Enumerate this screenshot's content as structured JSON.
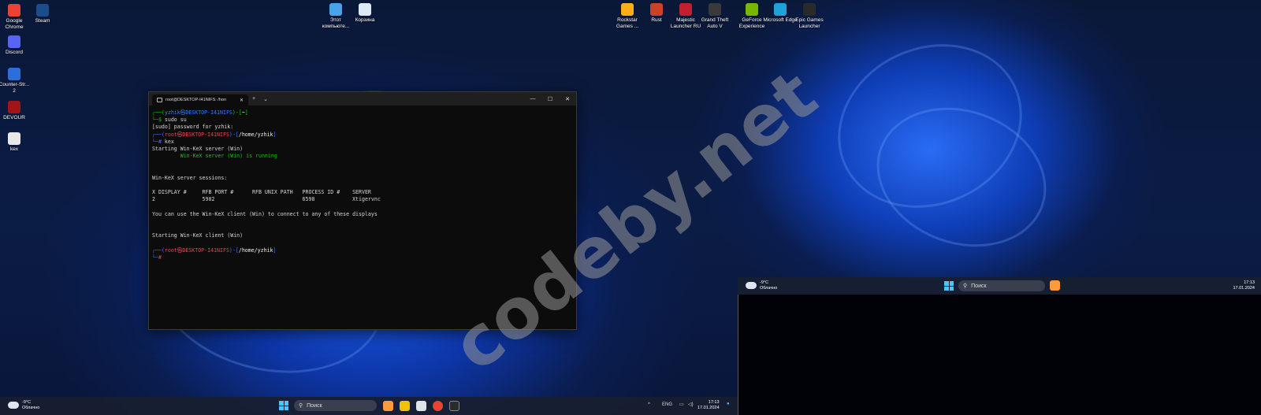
{
  "desktop_icons_left": [
    {
      "label": "Google Chrome",
      "icon": "chrome-icon",
      "color": "#ea4335"
    },
    {
      "label": "Steam",
      "icon": "steam-icon",
      "color": "#1b4d8a"
    },
    {
      "label": "Discord",
      "icon": "discord-icon",
      "color": "#5865f2"
    },
    {
      "label": "Counter-Str... 2",
      "icon": "cs2-icon",
      "color": "#2d6fd8"
    },
    {
      "label": "DEVOUR",
      "icon": "devour-icon",
      "color": "#a01616"
    },
    {
      "label": "kex",
      "icon": "file-icon",
      "color": "#e8e8e8"
    }
  ],
  "desktop_icons_mid": [
    {
      "label": "Этот компьюте...",
      "icon": "computer-icon",
      "color": "#4aa3e8"
    },
    {
      "label": "Корзина",
      "icon": "recycle-bin-icon",
      "color": "#dfe9f5"
    }
  ],
  "desktop_icons_right": [
    {
      "label": "Rockstar Games ...",
      "icon": "rockstar-icon",
      "color": "#fcaf17"
    },
    {
      "label": "Rust",
      "icon": "rust-icon",
      "color": "#cd412b"
    },
    {
      "label": "Majestic Launcher RU",
      "icon": "majestic-icon",
      "color": "#c21f2f"
    },
    {
      "label": "Grand Theft Auto V",
      "icon": "gta-icon",
      "color": "#3a3a3a"
    },
    {
      "label": "GeForce Experience",
      "icon": "geforce-icon",
      "color": "#76b900"
    },
    {
      "label": "Microsoft Edge",
      "icon": "edge-icon",
      "color": "#1fa2d8"
    },
    {
      "label": "Epic Games Launcher",
      "icon": "epic-icon",
      "color": "#2a2a2a"
    }
  ],
  "terminal": {
    "tab_title": "root@DESKTOP-I41NIFS: /hon",
    "new_tab": "+",
    "dropdown": "⌄",
    "minimize": "—",
    "maximize": "☐",
    "close": "✕",
    "lines": [
      {
        "parts": [
          {
            "t": "┌──(",
            "c": "c-green"
          },
          {
            "t": "yzhik㉿DESKTOP-I41NIFS",
            "c": "c-blue"
          },
          {
            "t": ")-[",
            "c": "c-green"
          },
          {
            "t": "~",
            "c": "c-white"
          },
          {
            "t": "]",
            "c": "c-green"
          }
        ]
      },
      {
        "parts": [
          {
            "t": "└─$ ",
            "c": "c-green"
          },
          {
            "t": "sudo su",
            "c": ""
          }
        ]
      },
      {
        "parts": [
          {
            "t": "[sudo] password for yzhik:",
            "c": ""
          }
        ]
      },
      {
        "parts": [
          {
            "t": "┌──(",
            "c": "c-blue"
          },
          {
            "t": "root㉿DESKTOP-I41NIFS",
            "c": "c-red"
          },
          {
            "t": ")-[",
            "c": "c-blue"
          },
          {
            "t": "/home/yzhik",
            "c": "c-white"
          },
          {
            "t": "]",
            "c": "c-blue"
          }
        ]
      },
      {
        "parts": [
          {
            "t": "└─# ",
            "c": "c-blue"
          },
          {
            "t": "kex",
            "c": ""
          }
        ]
      },
      {
        "parts": [
          {
            "t": "Starting Win-KeX server (Win)",
            "c": ""
          }
        ]
      },
      {
        "parts": [
          {
            "t": "         Win-KeX server (Win) is running",
            "c": "c-green"
          }
        ]
      },
      {
        "parts": [
          {
            "t": " ",
            "c": ""
          }
        ]
      },
      {
        "parts": [
          {
            "t": " ",
            "c": ""
          }
        ]
      },
      {
        "parts": [
          {
            "t": "Win-KeX server sessions:",
            "c": ""
          }
        ]
      },
      {
        "parts": [
          {
            "t": " ",
            "c": ""
          }
        ]
      },
      {
        "parts": [
          {
            "t": "X DISPLAY #     RFB PORT #      RFB UNIX PATH   PROCESS ID #    SERVER",
            "c": ""
          }
        ]
      },
      {
        "parts": [
          {
            "t": "2               5902                            6598            Xtigervnc",
            "c": ""
          }
        ]
      },
      {
        "parts": [
          {
            "t": " ",
            "c": ""
          }
        ]
      },
      {
        "parts": [
          {
            "t": "You can use the Win-KeX client (Win) to connect to any of these displays",
            "c": ""
          }
        ]
      },
      {
        "parts": [
          {
            "t": " ",
            "c": ""
          }
        ]
      },
      {
        "parts": [
          {
            "t": " ",
            "c": ""
          }
        ]
      },
      {
        "parts": [
          {
            "t": "Starting Win-KeX client (Win)",
            "c": ""
          }
        ]
      },
      {
        "parts": [
          {
            "t": " ",
            "c": ""
          }
        ]
      },
      {
        "parts": [
          {
            "t": "┌──(",
            "c": "c-blue"
          },
          {
            "t": "root㉿DESKTOP-I41NIFS",
            "c": "c-red"
          },
          {
            "t": ")-[",
            "c": "c-blue"
          },
          {
            "t": "/home/yzhik",
            "c": "c-white"
          },
          {
            "t": "]",
            "c": "c-blue"
          }
        ]
      },
      {
        "parts": [
          {
            "t": "└─",
            "c": "c-blue"
          },
          {
            "t": "#",
            "c": "c-red"
          }
        ]
      }
    ]
  },
  "watermark": "codeby.net",
  "taskbar_main": {
    "temp": "-9°C",
    "weather": "Облачно",
    "search_placeholder": "Поиск",
    "lang": "ENG",
    "time": "17:13",
    "date": "17.01.2024"
  },
  "taskbar_second": {
    "temp": "-9°C",
    "weather": "Облачно",
    "search_placeholder": "Поиск",
    "time": "17:13",
    "date": "17.01.2024"
  },
  "colors": {
    "accent": "#4cc2ff",
    "terminal_bg": "#0c0c0c"
  }
}
